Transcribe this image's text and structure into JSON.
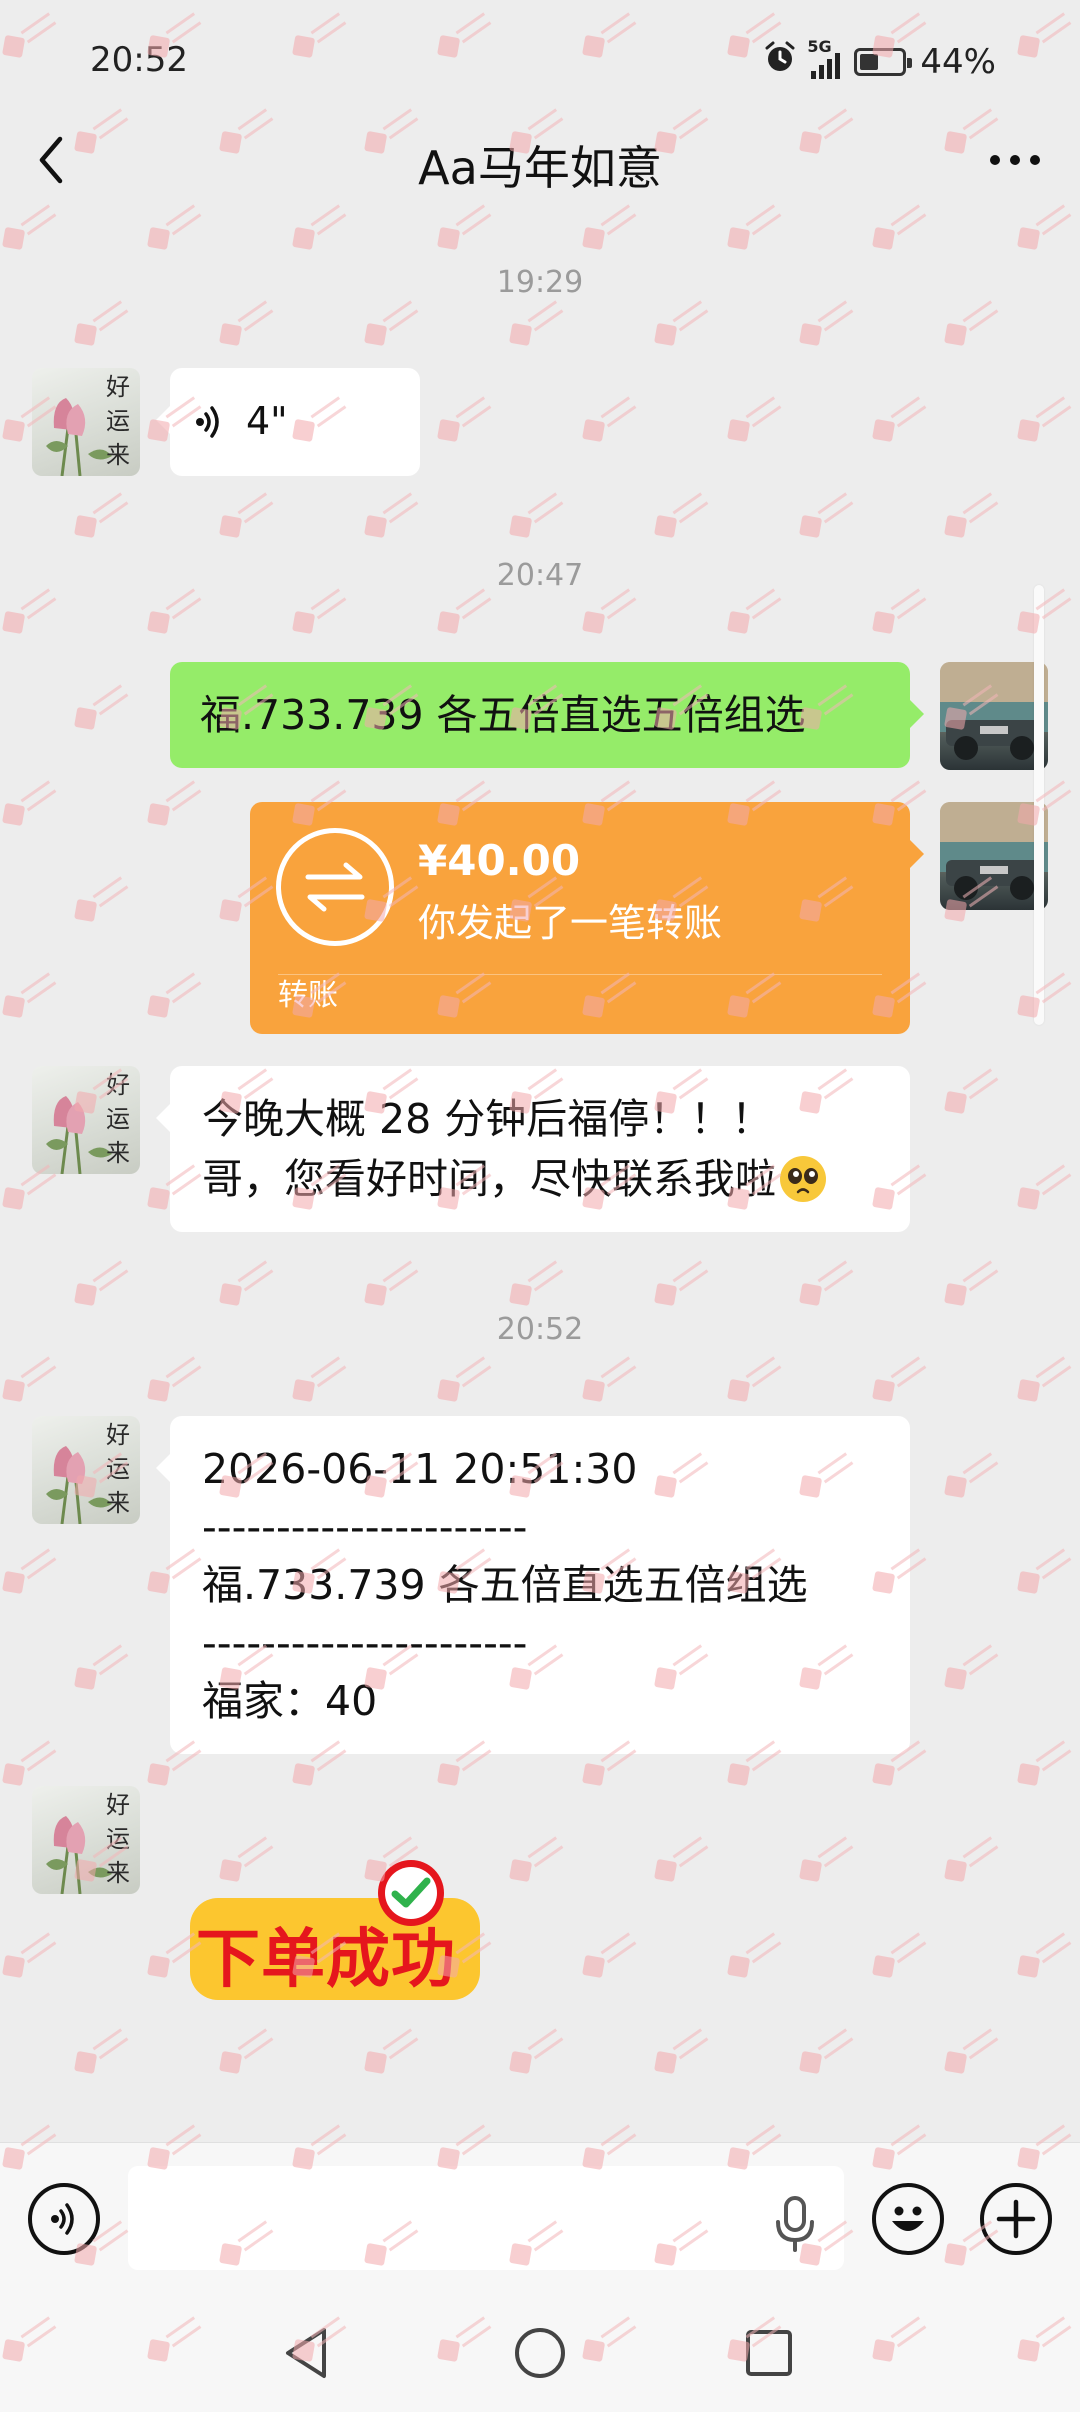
{
  "status_bar": {
    "time": "20:52",
    "network": "5G",
    "battery": "44%"
  },
  "header": {
    "title": "Aa马年如意"
  },
  "timestamps": [
    "19:29",
    "20:47",
    "20:52"
  ],
  "messages": {
    "voice": {
      "duration": "4\""
    },
    "sent_text": "福.733.739 各五倍直选五倍组选",
    "transfer": {
      "amount": "¥40.00",
      "description": "你发起了一笔转账",
      "footer": "转账"
    },
    "reminder": {
      "line1": "今晚大概 28 分钟后福停！！！",
      "line2": "哥，您看好时间，尽快联系我啦"
    },
    "receipt": {
      "datetime": "2026-06-11 20:51:30",
      "separator1": "----------------------",
      "content": "福.733.739 各五倍直选五倍组选",
      "separator2": "----------------------",
      "total": "福家：40"
    },
    "sticker": {
      "text": "下单成功"
    }
  },
  "avatar_left": {
    "calligraphy": "好运来"
  },
  "input": {
    "placeholder": ""
  },
  "colors": {
    "background": "#ededed",
    "sent_bubble": "#95ec69",
    "received_bubble": "#ffffff",
    "transfer_card": "#f9a33d",
    "sticker_red": "#e5161d",
    "sticker_yellow": "#fcc62f",
    "timestamp_gray": "#9b9b9b"
  },
  "icons": {
    "back": "chevron-left-icon",
    "more": "more-dots-icon",
    "voice": "voice-wave-icon",
    "transfer": "transfer-arrows-icon",
    "mic": "microphone-icon",
    "emoji": "emoji-icon",
    "plus": "plus-icon",
    "nav_back": "triangle-back-icon",
    "nav_home": "circle-home-icon",
    "nav_recents": "square-recents-icon",
    "check": "check-icon",
    "alarm": "alarm-icon",
    "signal": "signal-icon",
    "battery": "battery-icon"
  }
}
